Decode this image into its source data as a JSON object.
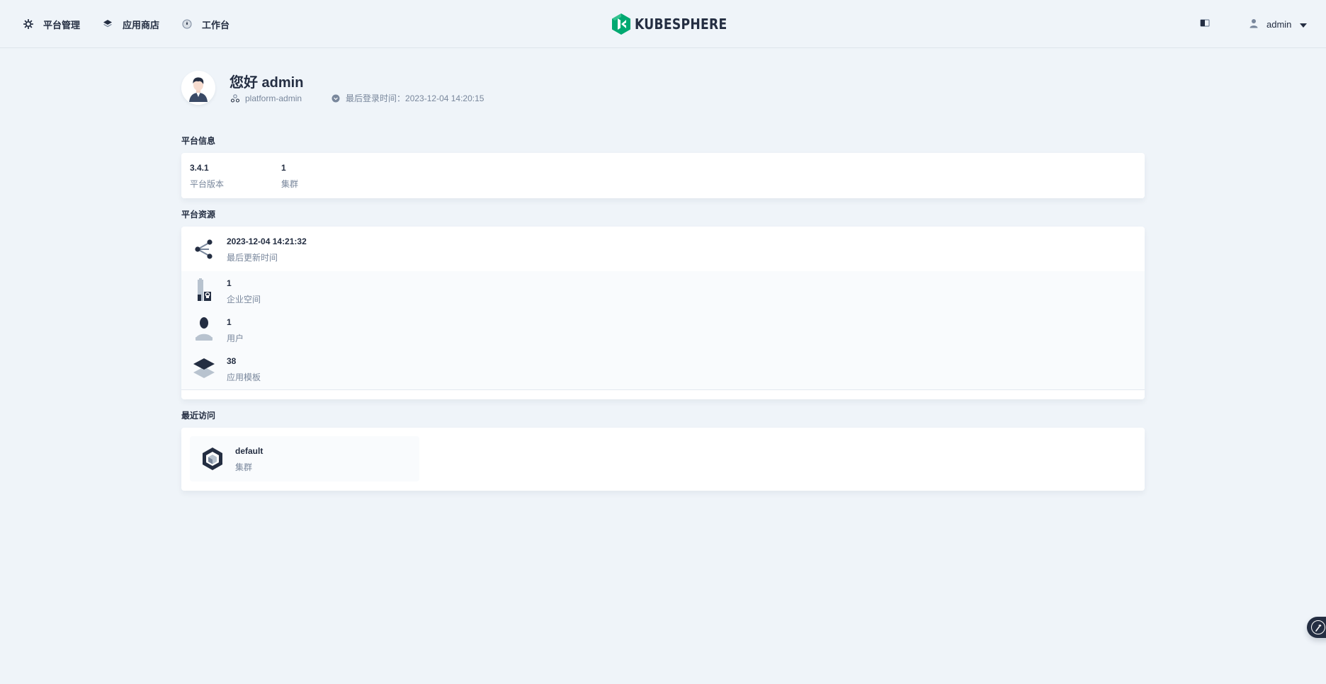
{
  "nav": {
    "items": [
      {
        "label": "平台管理",
        "icon": "gear-icon"
      },
      {
        "label": "应用商店",
        "icon": "layers-icon"
      },
      {
        "label": "工作台",
        "icon": "compass-icon"
      }
    ],
    "logo_text": "KUBESPHERE",
    "user": "admin"
  },
  "greeting": {
    "hello": "您好 admin",
    "role": "platform-admin",
    "last_login": "最后登录时间：2023-12-04 14:20:15"
  },
  "platform_info": {
    "title": "平台信息",
    "items": [
      {
        "value": "3.4.1",
        "label": "平台版本"
      },
      {
        "value": "1",
        "label": "集群"
      }
    ]
  },
  "platform_resources": {
    "title": "平台资源",
    "items": [
      {
        "value": "2023-12-04 14:21:32",
        "label": "最后更新时间",
        "icon": "share-nodes-icon"
      },
      {
        "value": "1",
        "label": "企业空间",
        "icon": "enterprise-space-icon"
      },
      {
        "value": "1",
        "label": "用户",
        "icon": "user-icon"
      },
      {
        "value": "38",
        "label": "应用模板",
        "icon": "app-template-icon"
      }
    ]
  },
  "recent": {
    "title": "最近访问",
    "items": [
      {
        "value": "default",
        "label": "集群",
        "icon": "cluster-icon"
      }
    ]
  },
  "colors": {
    "background": "#eff4f9",
    "text": "#242e42",
    "muted": "#79879c",
    "brand": "#00a971"
  }
}
